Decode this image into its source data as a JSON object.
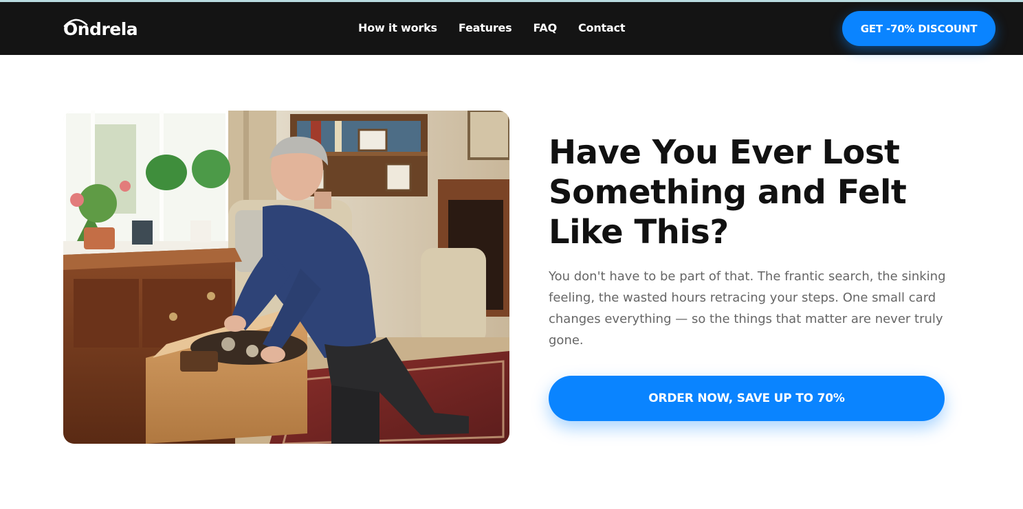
{
  "header": {
    "logo_text": "Ondrela",
    "nav": [
      {
        "label": "How it works"
      },
      {
        "label": "Features"
      },
      {
        "label": "FAQ"
      },
      {
        "label": "Contact"
      }
    ],
    "cta_label": "GET -70% DISCOUNT"
  },
  "hero": {
    "image_icon": "photo-elderly-man-searching-drawer",
    "headline": "Have You Ever Lost Something and Felt Like This?",
    "subtext": "You don't have to be part of that. The frantic search, the sinking feeling, the wasted hours retracing your steps. One small card changes everything — so the things that matter are never truly gone.",
    "cta_label": "ORDER NOW, SAVE UP TO 70%"
  },
  "colors": {
    "accent": "#0a84ff",
    "nav_background": "#141414",
    "headline": "#111111",
    "body_text": "#666666"
  }
}
